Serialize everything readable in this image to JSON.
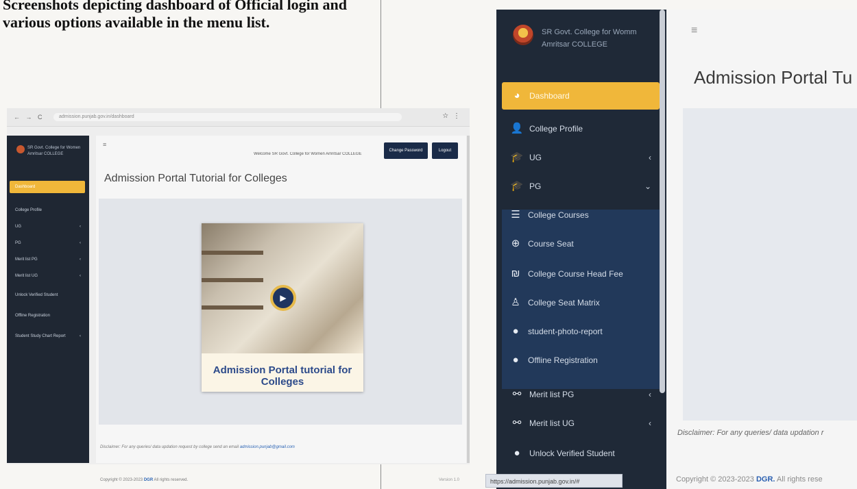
{
  "caption": {
    "line1": "Screenshots depicting dashboard of Official login and",
    "line2": "various options available in the menu list."
  },
  "small_screenshot": {
    "browser": {
      "nav_icons": "← → C",
      "url": "admission.punjab.gov.in/dashboard",
      "ext_icons": "☆ ⋮"
    },
    "brand": "SR Govt. College for Women Amritsar COLLEGE",
    "menu": [
      {
        "label": "Dashboard",
        "active": true
      },
      {
        "label": "College Profile"
      },
      {
        "label": "UG",
        "chevron": "‹"
      },
      {
        "label": "PG",
        "chevron": "‹"
      },
      {
        "label": "Merit list PG",
        "chevron": "‹"
      },
      {
        "label": "Merit list UG",
        "chevron": "‹"
      },
      {
        "label": "Unlock Verified Student"
      },
      {
        "label": "Offline Registration"
      },
      {
        "label": "Student Study Chart Report",
        "chevron": "‹"
      }
    ],
    "welcome": "Welcome SR Govt. College for Women Amritsar COLLEGE",
    "change_password": "Change Password",
    "logout": "Logout",
    "title": "Admission Portal Tutorial for Colleges",
    "video_caption": "Admission Portal tutorial for Colleges",
    "play_icon": "play-icon",
    "disclaimer": "Disclaimer: For any queries/ data updation request by college send an email",
    "disclaimer_link": "admission.punjab@gmail.com",
    "copyright_prefix": "Copyright © 2023-2023",
    "copyright_brand": "DGR",
    "copyright_suffix": "All rights reserved.",
    "version": "Version 1.0"
  },
  "zoomed": {
    "brand_line1": "SR Govt. College for Womm",
    "brand_line2": "Amritsar COLLEGE",
    "menu": [
      {
        "label": "Dashboard",
        "icon": "palette-icon",
        "glyph": "◕",
        "active": true
      },
      {
        "label": "College Profile",
        "icon": "user-icon",
        "glyph": "👤"
      },
      {
        "label": "UG",
        "icon": "graduation-cap-icon",
        "glyph": "🎓",
        "chevron": "‹"
      },
      {
        "label": "PG",
        "icon": "graduation-cap-icon",
        "glyph": "🎓",
        "chevron": "⌄"
      }
    ],
    "submenu": [
      {
        "label": "College Courses",
        "icon": "courses-icon",
        "glyph": "☰"
      },
      {
        "label": "Course Seat",
        "icon": "globe-icon",
        "glyph": "⊕"
      },
      {
        "label": "College Course Head Fee",
        "icon": "money-icon",
        "glyph": "₪"
      },
      {
        "label": "College Seat Matrix",
        "icon": "chair-icon",
        "glyph": "♙"
      },
      {
        "label": "student-photo-report",
        "icon": "circle-icon",
        "glyph": "●"
      },
      {
        "label": "Offline Registration",
        "icon": "circle-icon",
        "glyph": "●"
      }
    ],
    "menu_after": [
      {
        "label": "Merit list PG",
        "icon": "sitemap-icon",
        "glyph": "⚯",
        "chevron": "‹"
      },
      {
        "label": "Merit list UG",
        "icon": "sitemap-icon",
        "glyph": "⚯",
        "chevron": "‹"
      },
      {
        "label": "Unlock Verified Student",
        "icon": "circle-icon",
        "glyph": "●"
      }
    ],
    "status_url": "https://admission.punjab.gov.in/#",
    "hamburger": "≡",
    "title": "Admission Portal Tu",
    "disclaimer": "Disclaimer: For any queries/ data updation r",
    "copyright_prefix": "Copyright © 2023-2023",
    "copyright_brand": "DGR.",
    "copyright_suffix": "All rights rese"
  }
}
